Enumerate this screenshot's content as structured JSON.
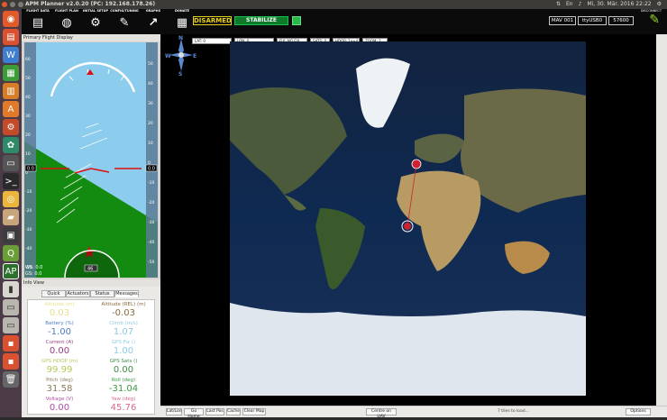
{
  "system_bar": {
    "title": "APM Planner v2.0.20 (PC: 192.168.178.26)",
    "clock": "Mi, 30. Mär. 2016 22:22"
  },
  "toolbar": {
    "buttons": [
      {
        "label": "FLIGHT DATA",
        "icon": "flight-data-icon"
      },
      {
        "label": "FLIGHT PLAN",
        "icon": "globe-icon"
      },
      {
        "label": "INITIAL SETUP",
        "icon": "gears-icon"
      },
      {
        "label": "CONFIG/TUNING",
        "icon": "wrench-icon"
      },
      {
        "label": "GRAPHS",
        "icon": "graph-icon"
      },
      {
        "label": "DONATE",
        "icon": "document-icon"
      }
    ],
    "arm_status": "DISARMED",
    "flight_mode": "STABILIZE",
    "mav_id": "MAV 001",
    "port": "ttyUSB0",
    "baud": "57600",
    "disconnect_label": "DISCONNECT",
    "colors": {
      "armed_status": "#e6d21c",
      "mode_bg": "#0f7a2c",
      "connect_icon": "#9ad636"
    }
  },
  "pfd": {
    "panel_title": "Primary Flight Display",
    "speed_readout": "0.0",
    "alt_readout": "0.0",
    "heading_readout": "46",
    "ws_label": "WS: 0.0",
    "gs_label": "GS: 0.0",
    "speed_ticks": [
      "60",
      "50",
      "40",
      "30",
      "20",
      "10",
      "0",
      "-10",
      "-20",
      "-30",
      "-40",
      "-50"
    ],
    "alt_ticks": [
      "50",
      "40",
      "30",
      "20",
      "10",
      "0",
      "-10",
      "-20",
      "-30",
      "-40",
      "-50"
    ],
    "colors": {
      "sky": "#8ccdee",
      "ground": "#138a10",
      "tape": "#5a7a94"
    }
  },
  "info_view": {
    "panel_title": "Info View",
    "tabs": [
      "Quick",
      "Actuators",
      "Status",
      "Messages"
    ],
    "active_tab": "Messages",
    "cells": [
      {
        "label": "Altitude (m)",
        "value": "0.03",
        "color": "#e8e08c"
      },
      {
        "label": "Altitude (REL) (m)",
        "value": "-0.03",
        "color": "#8b6a3c"
      },
      {
        "label": "Battery (%)",
        "value": "-1.00",
        "color": "#4a7cc0"
      },
      {
        "label": "Climb (m/s)",
        "value": "1.07",
        "color": "#8cc7e0"
      },
      {
        "label": "Current (A)",
        "value": "0.00",
        "color": "#9a3a88"
      },
      {
        "label": "GPS Fix ()",
        "value": "1.00",
        "color": "#8ccbe8"
      },
      {
        "label": "GPS HDOP (m)",
        "value": "99.99",
        "color": "#b9c45c"
      },
      {
        "label": "GPS Sats ()",
        "value": "0.00",
        "color": "#3e8a46"
      },
      {
        "label": "Pitch (deg)",
        "value": "31.58",
        "color": "#8c7a5a"
      },
      {
        "label": "Roll (deg)",
        "value": "-31.04",
        "color": "#3a9a3e"
      },
      {
        "label": "Voltage (V)",
        "value": "0.00",
        "color": "#b04aa8"
      },
      {
        "label": "Yaw (deg)",
        "value": "45.76",
        "color": "#d46a8c"
      }
    ]
  },
  "map": {
    "gps": {
      "lat": "LAT: 0",
      "lon": "LON: 0",
      "fix": "FIX: NO FIX",
      "sats": "SATS: 0",
      "hdop": "HDOP: 1e+4",
      "zoom": "ZOOM: 2"
    },
    "compass": {
      "n": "N",
      "s": "S",
      "e": "E",
      "w": "W"
    },
    "tiles_status": "7 tiles to load..."
  },
  "bottom_bar": {
    "buttons": [
      "Lat/Lon",
      "Go Home",
      "Last Pos",
      "Cache",
      "Clear Map"
    ],
    "centre_button": "Centre on UAV",
    "options": "Options"
  }
}
